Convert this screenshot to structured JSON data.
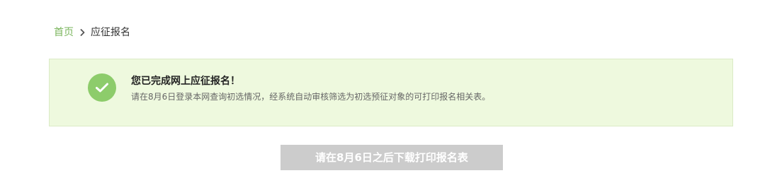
{
  "breadcrumb": {
    "home": "首页",
    "separator_icon": "chevron-right-icon",
    "current": "应征报名"
  },
  "notice": {
    "icon": "check-circle-icon",
    "title": "您已完成网上应征报名！",
    "description": "请在8月6日登录本网查询初选情况，经系统自动审核筛选为初选预征对象的可打印报名相关表。"
  },
  "download_button": {
    "label": "请在8月6日之后下载打印报名表",
    "state": "disabled"
  },
  "colors": {
    "accent_green": "#7ab55c",
    "notice_background": "#eef9de",
    "check_badge": "#8dcc6b",
    "disabled_button": "#cccccc"
  }
}
